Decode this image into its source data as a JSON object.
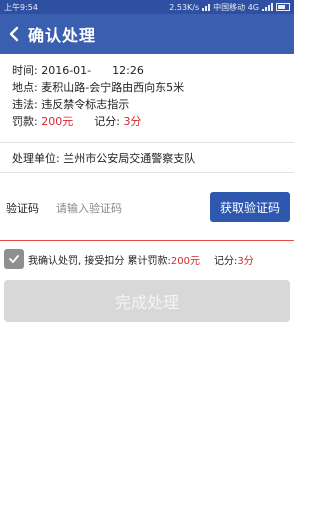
{
  "status_bar": {
    "time": "上午9:54",
    "net_speed": "2.53K/s",
    "carrier": "中国移动 4G"
  },
  "header": {
    "title": "确认处理",
    "icon_back": "chevron-left-icon"
  },
  "violation": {
    "time_label": "时间:",
    "time_value": "2016-01-",
    "time_clock": "12:26",
    "place_label": "地点:",
    "place_value": "麦积山路-会宁路由西向东5米",
    "violation_label": "违法:",
    "violation_value": "违反禁令标志指示",
    "fine_label": "罚款:",
    "fine_value": "200元",
    "points_label": "记分:",
    "points_value": "3分"
  },
  "department": {
    "label": "处理单位:",
    "value": "兰州市公安局交通警察支队"
  },
  "verify": {
    "label": "验证码",
    "placeholder": "请输入验证码",
    "value": "",
    "button_label": "获取验证码"
  },
  "agreement": {
    "text": "我确认处罚, 接受扣分 累计罚款:",
    "fine": "200元",
    "points_label": "记分:",
    "points": "3分",
    "checked": true
  },
  "submit": {
    "label": "完成处理",
    "enabled": false
  },
  "colors": {
    "header_blue": "#3b5fb0",
    "button_blue": "#2e58b0",
    "red": "#d9262d",
    "disabled_gray": "#d8d8d8"
  }
}
